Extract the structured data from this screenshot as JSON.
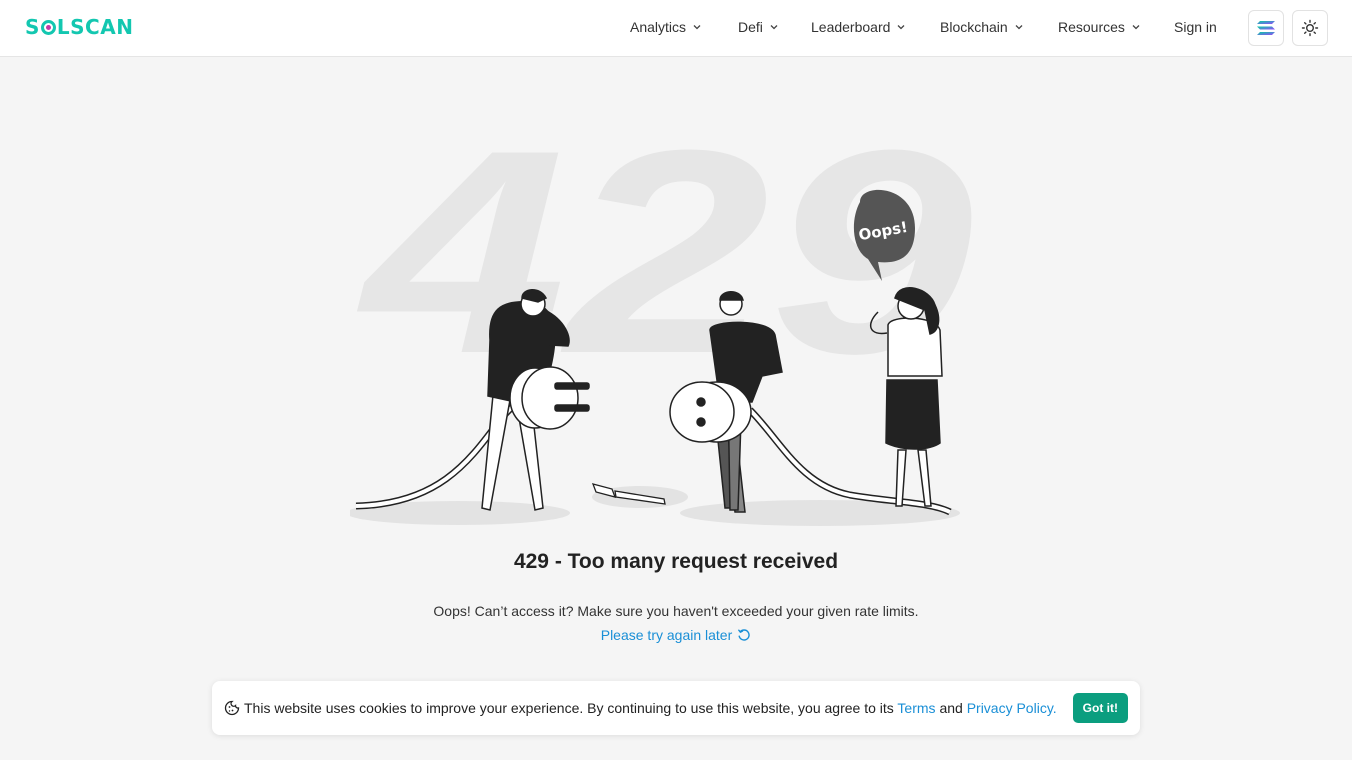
{
  "header": {
    "logo": "SOLSCAN",
    "nav": [
      {
        "label": "Analytics"
      },
      {
        "label": "Defi"
      },
      {
        "label": "Leaderboard"
      },
      {
        "label": "Blockchain"
      },
      {
        "label": "Resources"
      }
    ],
    "sign_in": "Sign in"
  },
  "illustration": {
    "big_number": "429",
    "speech_bubble": "Oops!"
  },
  "error": {
    "title": "429 - Too many request received",
    "description": "Oops! Can’t access it? Make sure you haven't exceeded your given rate limits.",
    "retry_link": "Please try again later"
  },
  "cookie": {
    "text_before": "This website uses cookies to improve your experience. By continuing to use this website, you agree to its",
    "terms_link": "Terms",
    "and_text": "and",
    "privacy_link": "Privacy Policy",
    "period": ".",
    "accept_button": "Got it!"
  },
  "colors": {
    "brand": "#13c7b0",
    "link": "#1a8fd6",
    "accept_button": "#0b9e7f"
  }
}
